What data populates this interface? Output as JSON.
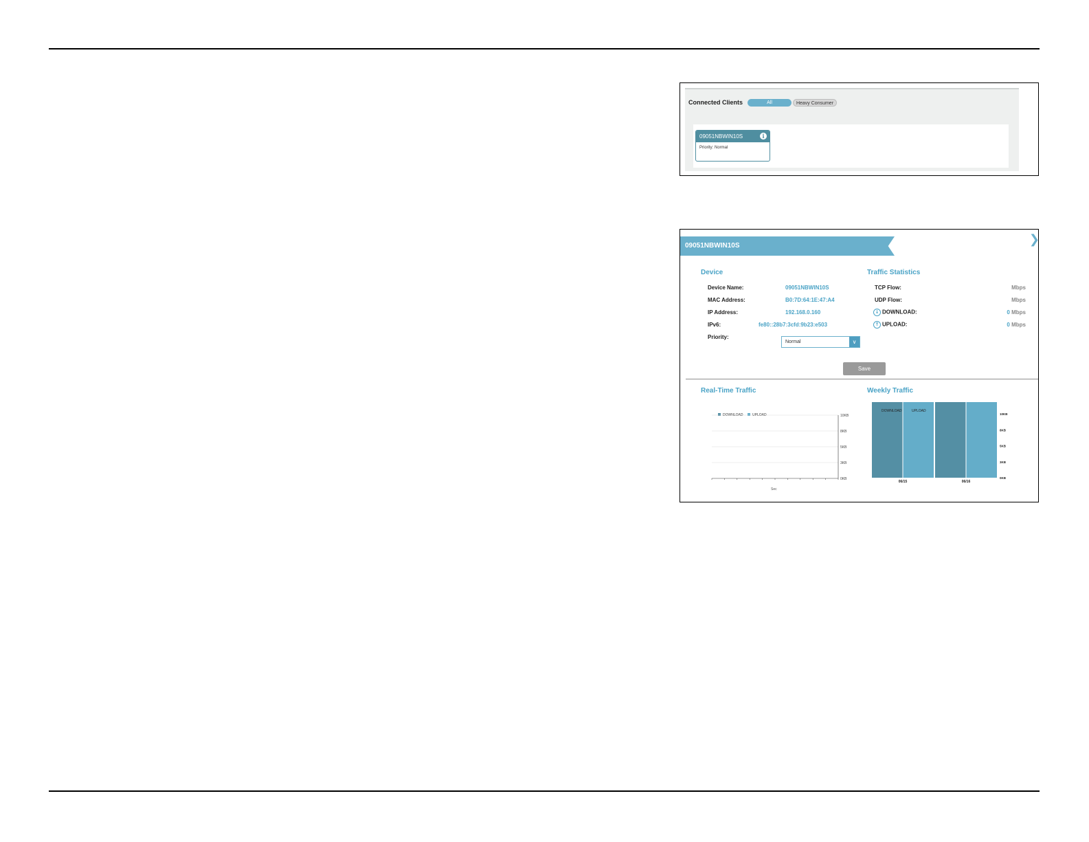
{
  "clients_panel": {
    "title": "Connected Clients",
    "filters": {
      "all": "All",
      "heavy": "Heavy Consumer"
    },
    "client": {
      "name": "09051NBWIN10S",
      "priority": "Priority: Normal"
    }
  },
  "detail_panel": {
    "banner_title": "09051NBWIN10S",
    "device": {
      "title": "Device",
      "rows": [
        {
          "label": "Device Name:",
          "value": "09051NBWIN10S"
        },
        {
          "label": "MAC Address:",
          "value": "B0:7D:64:1E:47:A4"
        },
        {
          "label": "IP Address:",
          "value": "192.168.0.160"
        },
        {
          "label": "IPv6:",
          "value": "fe80::28b7:3cfd:9b23:e503"
        },
        {
          "label": "Priority:"
        }
      ],
      "priority_selected": "Normal"
    },
    "traffic_stats": {
      "title": "Traffic Statistics",
      "tcp": {
        "label": "TCP Flow:",
        "unit": "Mbps"
      },
      "udp": {
        "label": "UDP Flow:",
        "unit": "Mbps"
      },
      "download": {
        "label": "DOWNLOAD:",
        "value": "0",
        "unit": "Mbps"
      },
      "upload": {
        "label": "UPLOAD:",
        "value": "0",
        "unit": "Mbps"
      }
    },
    "save_label": "Save",
    "realtime_title": "Real-Time Traffic",
    "weekly_title": "Weekly Traffic"
  },
  "colors": {
    "accent": "#6ab0cc",
    "dark_accent": "#4f8ea0",
    "download": "#548fa4",
    "upload": "#64adc9"
  },
  "chart_data": [
    {
      "type": "line",
      "series": [
        {
          "name": "DOWNLOAD",
          "values": []
        },
        {
          "name": "UPLOAD",
          "values": []
        }
      ],
      "xlabel": "Sec",
      "y_ticks": [
        "10KB",
        "8KB",
        "5KB",
        "3KB",
        "0KB"
      ],
      "grid": true,
      "legend": "top-left"
    },
    {
      "type": "bar",
      "categories": [
        "06/15",
        "06/16"
      ],
      "series": [
        {
          "name": "DOWNLOAD",
          "values": [
            10,
            10
          ]
        },
        {
          "name": "UPLOAD",
          "values": [
            10,
            10
          ]
        }
      ],
      "y_ticks": [
        "10KB",
        "8KB",
        "5KB",
        "3KB",
        "0KB"
      ],
      "ylim": [
        0,
        10
      ],
      "legend": "top"
    }
  ]
}
